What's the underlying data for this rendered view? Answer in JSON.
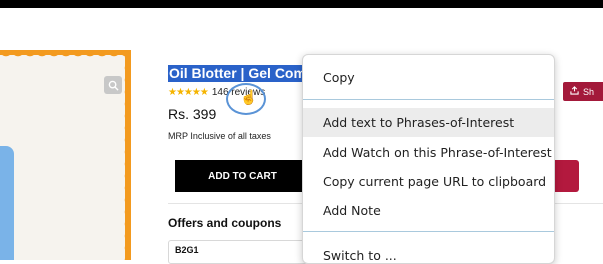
{
  "product": {
    "title": "Oil Blotter | Gel Com",
    "stars": "★★★★★",
    "reviews": "146 reviews",
    "price": "Rs. 399",
    "mrp_note": "MRP Inclusive of all taxes",
    "add_to_cart": "ADD TO CART",
    "share": "Sh",
    "offers_title": "Offers and coupons",
    "coupon_code": "B2G1"
  },
  "context_menu": {
    "items": [
      {
        "label": "Copy"
      },
      {
        "label": "Add text to Phrases-of-Interest"
      },
      {
        "label": "Add Watch on this Phrase-of-Interest"
      },
      {
        "label": "Copy current page URL to clipboard"
      },
      {
        "label": "Add Note"
      },
      {
        "label": "Switch to ..."
      }
    ]
  },
  "icons": {
    "zoom": "zoom-icon",
    "share": "share-icon",
    "cursor": "hand-pointer-icon"
  },
  "colors": {
    "selection": "#2a62c9",
    "brand_red": "#a3193a",
    "scallop_orange": "#f39a1f",
    "star_yellow": "#f5b400",
    "menu_hover": "#ececec"
  }
}
